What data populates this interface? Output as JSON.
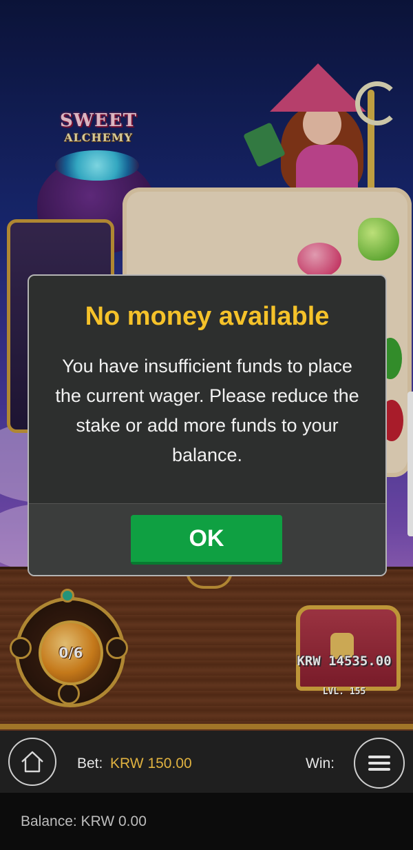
{
  "game": {
    "logo_line1": "SWEET",
    "logo_line2": "ALCHEMY",
    "collect_meter": "0/6",
    "chest_amount": "KRW 14535.00",
    "chest_level": "LVL. 155"
  },
  "dialog": {
    "title": "No money available",
    "message": "You have insufficient funds to place the current wager. Please reduce the stake or add more funds to your balance.",
    "ok_label": "OK"
  },
  "bottom_bar": {
    "home_icon": "home-icon",
    "bet_label": "Bet:",
    "bet_value": "KRW 150.00",
    "win_label": "Win:",
    "menu_icon": "hamburger-menu-icon",
    "balance_text": "Balance: KRW 0.00"
  },
  "colors": {
    "dialog_title": "#f5c22a",
    "ok_button": "#0fa042",
    "bet_value": "#e0b240"
  }
}
